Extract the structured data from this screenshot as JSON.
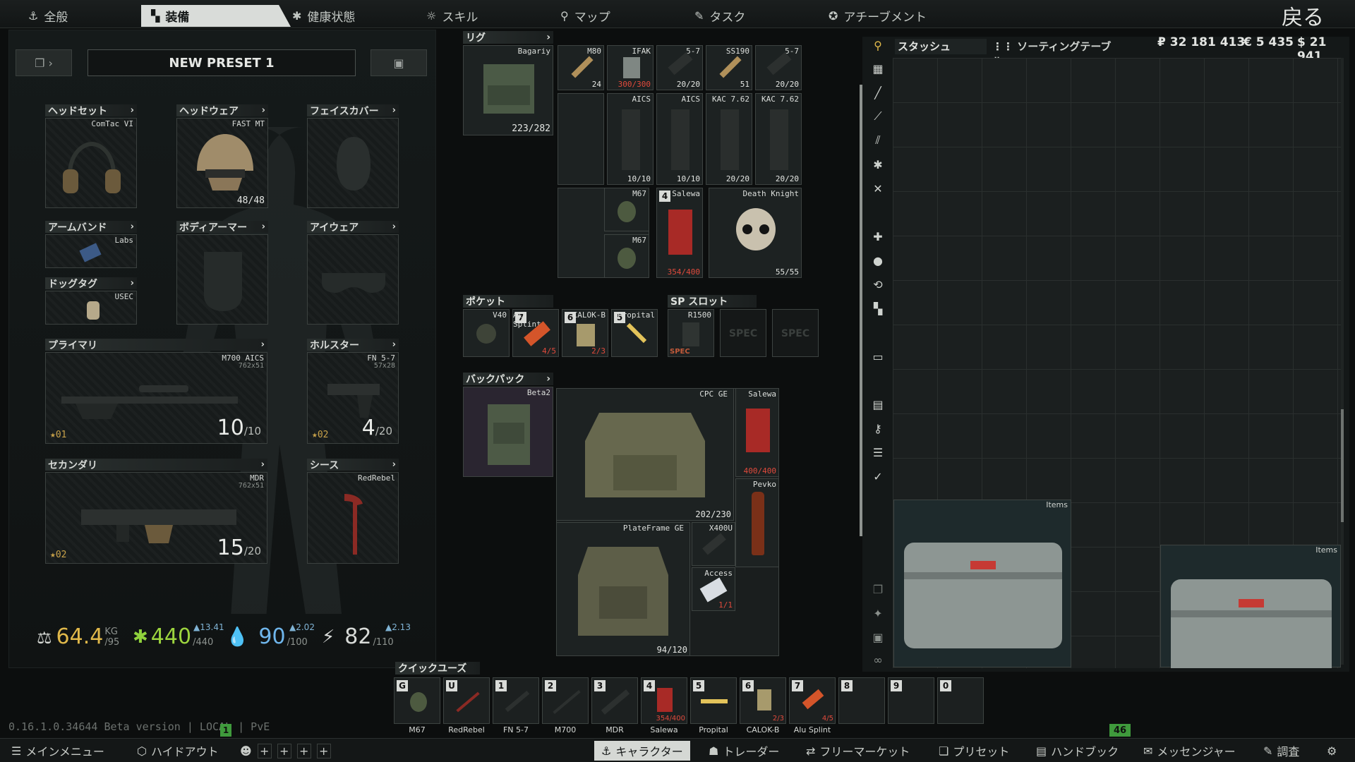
{
  "top_tabs": [
    {
      "label": "全般",
      "icon": "anchor-icon"
    },
    {
      "label": "装備",
      "icon": "armor-icon"
    },
    {
      "label": "健康状態",
      "icon": "medical-icon"
    },
    {
      "label": "スキル",
      "icon": "bulb-icon"
    },
    {
      "label": "マップ",
      "icon": "map-pin-icon"
    },
    {
      "label": "タスク",
      "icon": "task-icon"
    },
    {
      "label": "アチーブメント",
      "icon": "achievement-icon"
    }
  ],
  "back_label": "戻る",
  "preset": {
    "name": "NEW PRESET 1"
  },
  "slots": {
    "headset": {
      "label": "ヘッドセット",
      "item": "ComTac VI"
    },
    "headwear": {
      "label": "ヘッドウェア",
      "item": "FAST MT",
      "durability": "48/48"
    },
    "facecover": {
      "label": "フェイスカバー"
    },
    "armband": {
      "label": "アームバンド",
      "item": "Labs"
    },
    "body_armor": {
      "label": "ボディアーマー"
    },
    "eyewear": {
      "label": "アイウェア"
    },
    "dogtag": {
      "label": "ドッグタグ",
      "item": "USEC"
    },
    "primary": {
      "label": "プライマリ",
      "item": "M700 AICS",
      "caliber": "762x51",
      "ammo": "10",
      "cap": "/10",
      "rank": "01"
    },
    "holster": {
      "label": "ホルスター",
      "item": "FN 5-7",
      "caliber": "57x28",
      "ammo": "4",
      "cap": "/20",
      "rank": "02"
    },
    "secondary": {
      "label": "セカンダリ",
      "item": "MDR",
      "caliber": "762x51",
      "ammo": "15",
      "cap": "/20",
      "rank": "02"
    },
    "scabbard": {
      "label": "シース",
      "item": "RedRebel"
    }
  },
  "stats": {
    "weight": {
      "value": "64.4",
      "unit": "KG",
      "max": "/95"
    },
    "health": {
      "value": "440",
      "max": "/440",
      "delta": "▲13.41"
    },
    "hydration": {
      "value": "90",
      "max": "/100",
      "delta": "▲2.02"
    },
    "energy": {
      "value": "82",
      "max": "/110",
      "delta": "▲2.13"
    }
  },
  "rig": {
    "label": "リグ",
    "item": "Bagariy",
    "durability": "223/282",
    "cells": [
      {
        "name": "M80",
        "value": "24"
      },
      {
        "name": "IFAK",
        "value": "300/300"
      },
      {
        "name": "5-7",
        "value": "20/20"
      },
      {
        "name": "SS190",
        "value": "51"
      },
      {
        "name": "5-7",
        "value": "20/20"
      },
      {
        "name": "AICS",
        "value": "10/10"
      },
      {
        "name": "AICS",
        "value": "10/10"
      },
      {
        "name": "KAC 7.62",
        "value": "20/20"
      },
      {
        "name": "KAC 7.62",
        "value": "20/20"
      },
      {
        "name": "M67",
        "value": ""
      },
      {
        "name": "M67",
        "value": ""
      },
      {
        "name": "Salewa",
        "value": "354/400",
        "count": "4"
      },
      {
        "name": "Death Knight",
        "value": "55/55"
      }
    ]
  },
  "pockets": {
    "label": "ポケット",
    "cells": [
      {
        "name": "V40",
        "value": "",
        "count": ""
      },
      {
        "name": "Alu Splint",
        "value": "4/5",
        "count": "7"
      },
      {
        "name": "CALOK-B",
        "value": "2/3",
        "count": "6"
      },
      {
        "name": "Propital",
        "value": "",
        "count": "5"
      }
    ]
  },
  "sp_slots": {
    "label": "SP スロット",
    "cells": [
      {
        "name": "R1500",
        "tag": "SPEC"
      },
      {
        "name": "",
        "tag": "SPEC"
      },
      {
        "name": "",
        "tag": "SPEC"
      }
    ]
  },
  "backpack": {
    "label": "バックパック",
    "item": "Beta2",
    "cells": [
      {
        "name": "CPC GE",
        "value": "202/230"
      },
      {
        "name": "Salewa",
        "value": "400/400"
      },
      {
        "name": "Pevko",
        "value": ""
      },
      {
        "name": "PlateFrame GE",
        "value": "94/120"
      },
      {
        "name": "X400U",
        "value": ""
      },
      {
        "name": "Access",
        "value": "1/1"
      }
    ]
  },
  "stash": {
    "tabs": [
      "スタッシュ",
      "ソーティングテーブル"
    ],
    "currency": {
      "rub": "₽ 32 181 413",
      "eur": "€ 5 435",
      "usd": "$ 21 941"
    },
    "items": [
      {
        "name": "Items"
      },
      {
        "name": "Items"
      }
    ]
  },
  "quick_use": {
    "label": "クイックユーズ",
    "slots": [
      {
        "key": "G",
        "name": "M67",
        "value": ""
      },
      {
        "key": "U",
        "name": "RedRebel",
        "value": ""
      },
      {
        "key": "1",
        "name": "FN 5-7",
        "value": ""
      },
      {
        "key": "2",
        "name": "M700",
        "value": ""
      },
      {
        "key": "3",
        "name": "MDR",
        "value": ""
      },
      {
        "key": "4",
        "name": "Salewa",
        "value": "354/400"
      },
      {
        "key": "5",
        "name": "Propital",
        "value": ""
      },
      {
        "key": "6",
        "name": "CALOK-B",
        "value": "2/3"
      },
      {
        "key": "7",
        "name": "Alu Splint",
        "value": "4/5"
      },
      {
        "key": "8",
        "name": "",
        "value": ""
      },
      {
        "key": "9",
        "name": "",
        "value": ""
      },
      {
        "key": "0",
        "name": "",
        "value": ""
      }
    ]
  },
  "version": "0.16.1.0.34644 Beta version | LOCAL | PvE",
  "badges": {
    "left": "1",
    "right": "46"
  },
  "bottom_nav": [
    {
      "label": "メインメニュー",
      "icon": "menu-icon"
    },
    {
      "label": "ハイドアウト",
      "icon": "hideout-icon"
    },
    {
      "label": "キャラクター",
      "icon": "character-icon"
    },
    {
      "label": "トレーダー",
      "icon": "traders-icon"
    },
    {
      "label": "フリーマーケット",
      "icon": "flea-icon"
    },
    {
      "label": "プリセット",
      "icon": "preset-icon"
    },
    {
      "label": "ハンドブック",
      "icon": "handbook-icon"
    },
    {
      "label": "メッセンジャー",
      "icon": "messenger-icon"
    },
    {
      "label": "調査",
      "icon": "survey-icon"
    }
  ],
  "colors": {
    "accent": "#d9dcd9",
    "rarity_red": "#e04a3c",
    "gold": "#c8a24a",
    "badge_green": "#3f9a3c"
  }
}
